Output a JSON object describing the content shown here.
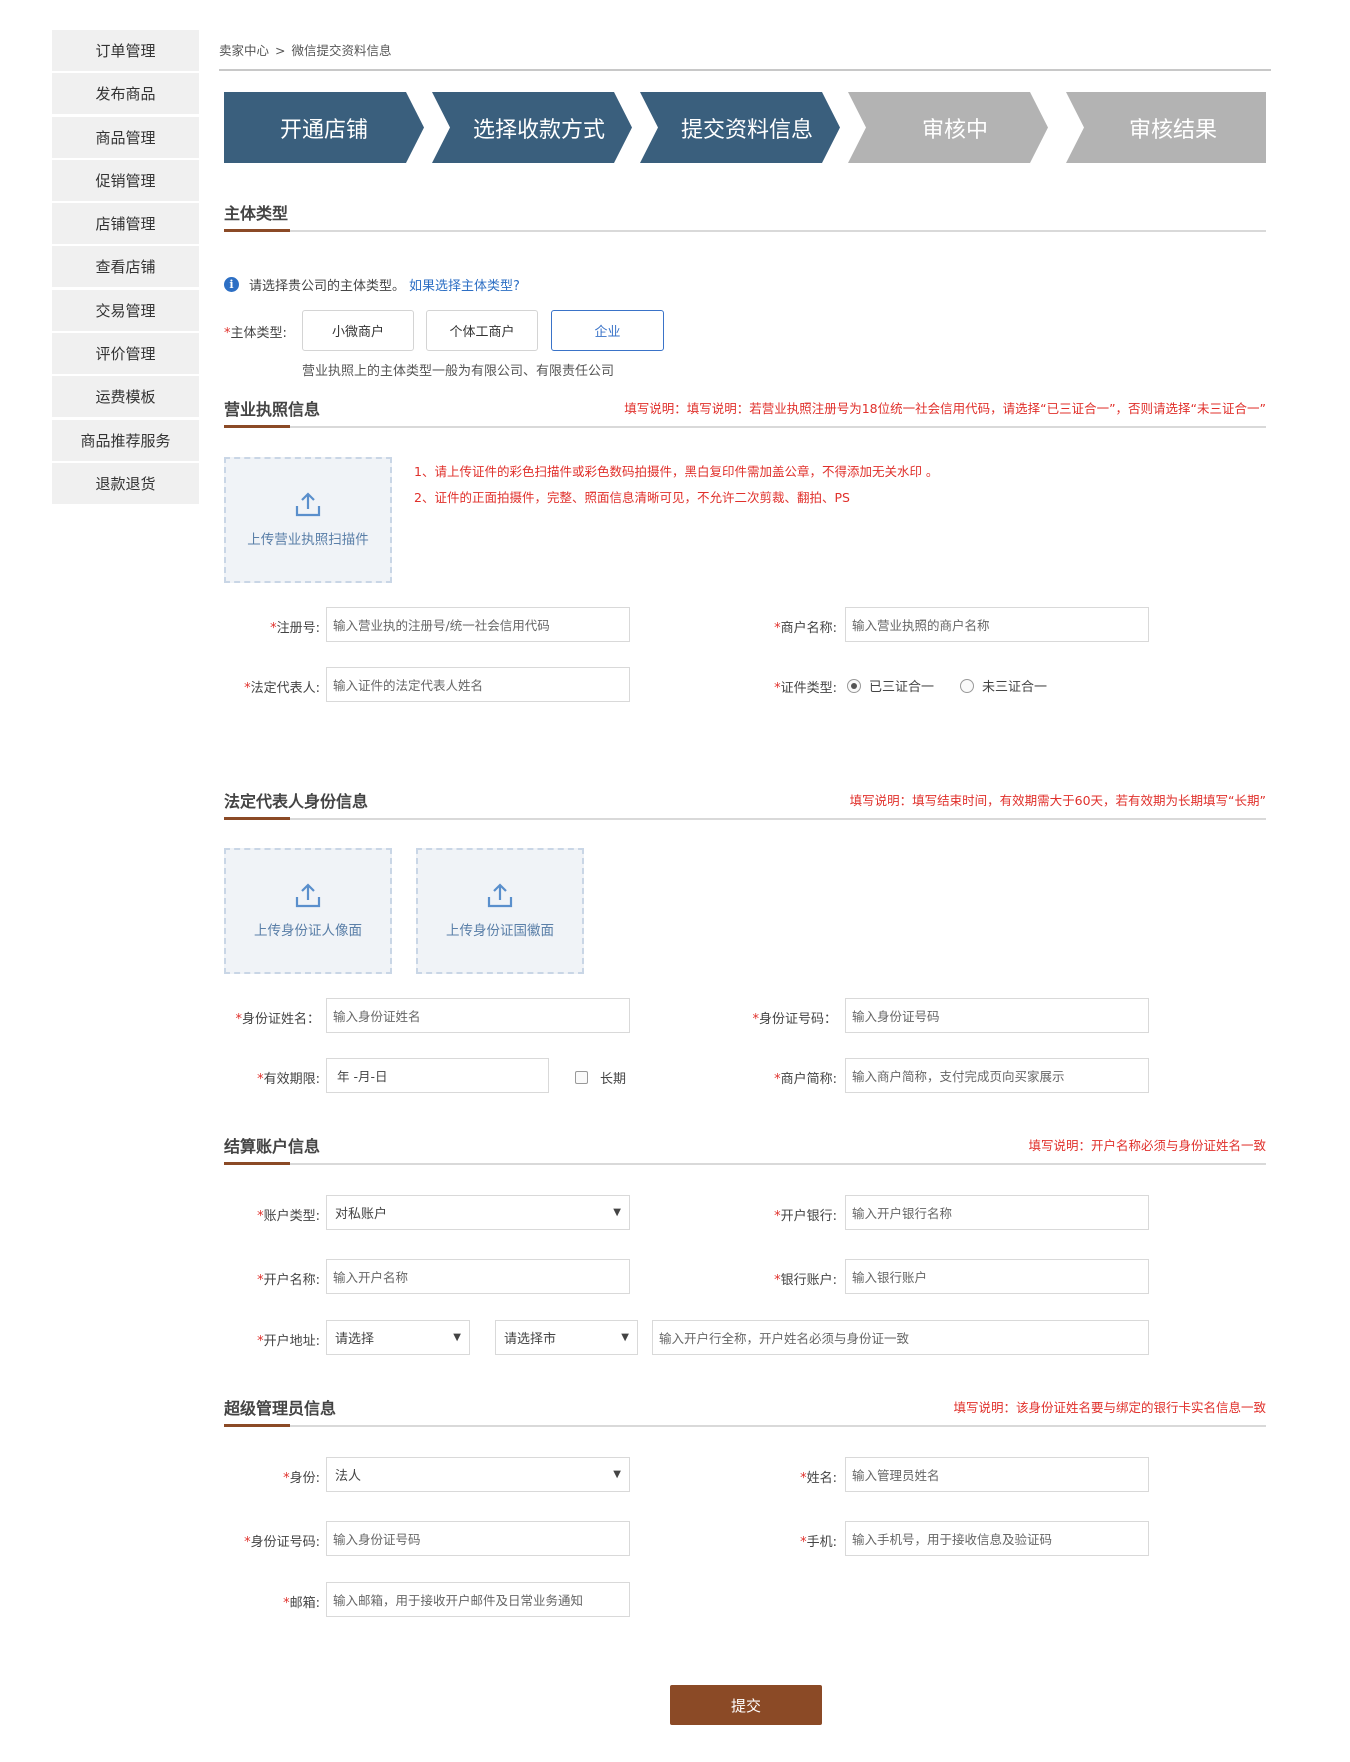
{
  "sidebar": {
    "items": [
      "订单管理",
      "发布商品",
      "商品管理",
      "促销管理",
      "店铺管理",
      "查看店铺",
      "交易管理",
      "评价管理",
      "运费模板",
      "商品推荐服务",
      "退款退货"
    ]
  },
  "breadcrumb": {
    "home": "卖家中心",
    "separator": ">",
    "current": "微信提交资料信息"
  },
  "steps": [
    {
      "label": "开通店铺",
      "state": "done"
    },
    {
      "label": "选择收款方式",
      "state": "done"
    },
    {
      "label": "提交资料信息",
      "state": "done"
    },
    {
      "label": "审核中",
      "state": "todo"
    },
    {
      "label": "审核结果",
      "state": "todo"
    }
  ],
  "colors": {
    "step_done": "#3a5f7d",
    "step_todo": "#b3b3b3",
    "accent": "#8b4a26",
    "link": "#2d6fc4",
    "required": "#e0302b"
  },
  "subject": {
    "title": "主体类型",
    "info_text": "请选择贵公司的主体类型。",
    "info_link": "如果选择主体类型?",
    "label": "主体类型:",
    "options": [
      "小微商户",
      "个体工商户",
      "企业"
    ],
    "selected": "企业",
    "hint": "营业执照上的主体类型一般为有限公司、有限责任公司"
  },
  "license": {
    "title": "营业执照信息",
    "note": "填写说明：填写说明：若营业执照注册号为18位统一社会信用代码，请选择“已三证合一”，否则请选择“未三证合一”",
    "upload_label": "上传营业执照扫描件",
    "rule1": "1、请上传证件的彩色扫描件或彩色数码拍摄件，黑白复印件需加盖公章，不得添加无关水印 。",
    "rule2": "2、证件的正面拍摄件，完整、照面信息清晰可见，不允许二次剪裁、翻拍、PS",
    "reg_no_label": "注册号:",
    "reg_no_placeholder": "输入营业执的注册号/统一社会信用代码",
    "merchant_name_label": "商户名称:",
    "merchant_name_placeholder": "输入营业执照的商户名称",
    "legal_rep_label": "法定代表人:",
    "legal_rep_placeholder": "输入证件的法定代表人姓名",
    "cert_type_label": "证件类型:",
    "cert_type_options": [
      "已三证合一",
      "未三证合一"
    ],
    "cert_type_selected": "已三证合一"
  },
  "legal_id": {
    "title": "法定代表人身份信息",
    "note": "填写说明：填写结束时间，有效期需大于60天，若有效期为长期填写“长期”",
    "upload_front": "上传身份证人像面",
    "upload_back": "上传身份证国徽面",
    "id_name_label": "身份证姓名：",
    "id_name_placeholder": "输入身份证姓名",
    "id_no_label": "身份证号码：",
    "id_no_placeholder": "输入身份证号码",
    "valid_label": "有效期限:",
    "valid_placeholder": "年 -月-日",
    "long_term": "长期",
    "short_name_label": "商户简称:",
    "short_name_placeholder": "输入商户简称，支付完成页向买家展示"
  },
  "settlement": {
    "title": "结算账户信息",
    "note": "填写说明：开户名称必须与身份证姓名一致",
    "account_type_label": "账户类型:",
    "account_type_value": "对私账户",
    "bank_label": "开户银行:",
    "bank_placeholder": "输入开户银行名称",
    "account_name_label": "开户名称:",
    "account_name_placeholder": "输入开户名称",
    "account_no_label": "银行账户:",
    "account_no_placeholder": "输入银行账户",
    "address_label": "开户地址:",
    "province_value": "请选择",
    "city_value": "请选择市",
    "branch_placeholder": "输入开户行全称，开户姓名必须与身份证一致"
  },
  "admin": {
    "title": "超级管理员信息",
    "note": "填写说明：该身份证姓名要与绑定的银行卡实名信息一致",
    "identity_label": "身份:",
    "identity_value": "法人",
    "name_label": "姓名:",
    "name_placeholder": "输入管理员姓名",
    "id_no_label": "身份证号码:",
    "id_no_placeholder": "输入身份证号码",
    "phone_label": "手机:",
    "phone_placeholder": "输入手机号，用于接收信息及验证码",
    "email_label": "邮箱:",
    "email_placeholder": "输入邮箱，用于接收开户邮件及日常业务通知"
  },
  "submit_label": "提交",
  "required_mark": "*"
}
